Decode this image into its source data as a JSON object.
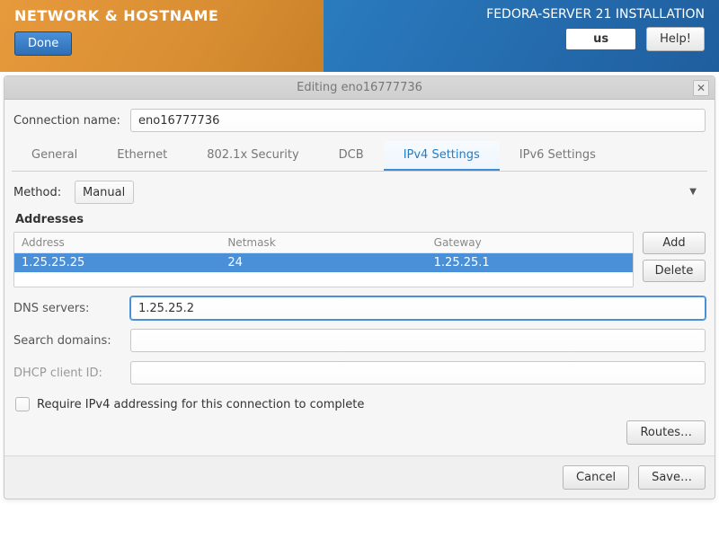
{
  "banner": {
    "left_title": "NETWORK & HOSTNAME",
    "done_label": "Done",
    "right_title": "FEDORA-SERVER 21 INSTALLATION",
    "keyboard_indicator": "us",
    "help_label": "Help!"
  },
  "dialog": {
    "title": "Editing eno16777736",
    "connection_name_label": "Connection name:",
    "connection_name_value": "eno16777736",
    "tabs": {
      "general": "General",
      "ethernet": "Ethernet",
      "dot1x": "802.1x Security",
      "dcb": "DCB",
      "ipv4": "IPv4 Settings",
      "ipv6": "IPv6 Settings"
    },
    "method_label": "Method:",
    "method_value": "Manual",
    "addresses_title": "Addresses",
    "addr_headers": {
      "address": "Address",
      "netmask": "Netmask",
      "gateway": "Gateway"
    },
    "addr_row": {
      "address": "1.25.25.25",
      "netmask": "24",
      "gateway": "1.25.25.1"
    },
    "add_label": "Add",
    "delete_label": "Delete",
    "dns_label": "DNS servers:",
    "dns_value": "1.25.25.2",
    "search_label": "Search domains:",
    "search_value": "",
    "dhcp_client_label": "DHCP client ID:",
    "dhcp_client_value": "",
    "require_ipv4_label": "Require IPv4 addressing for this connection to complete",
    "routes_label": "Routes…",
    "cancel_label": "Cancel",
    "save_label": "Save…"
  }
}
